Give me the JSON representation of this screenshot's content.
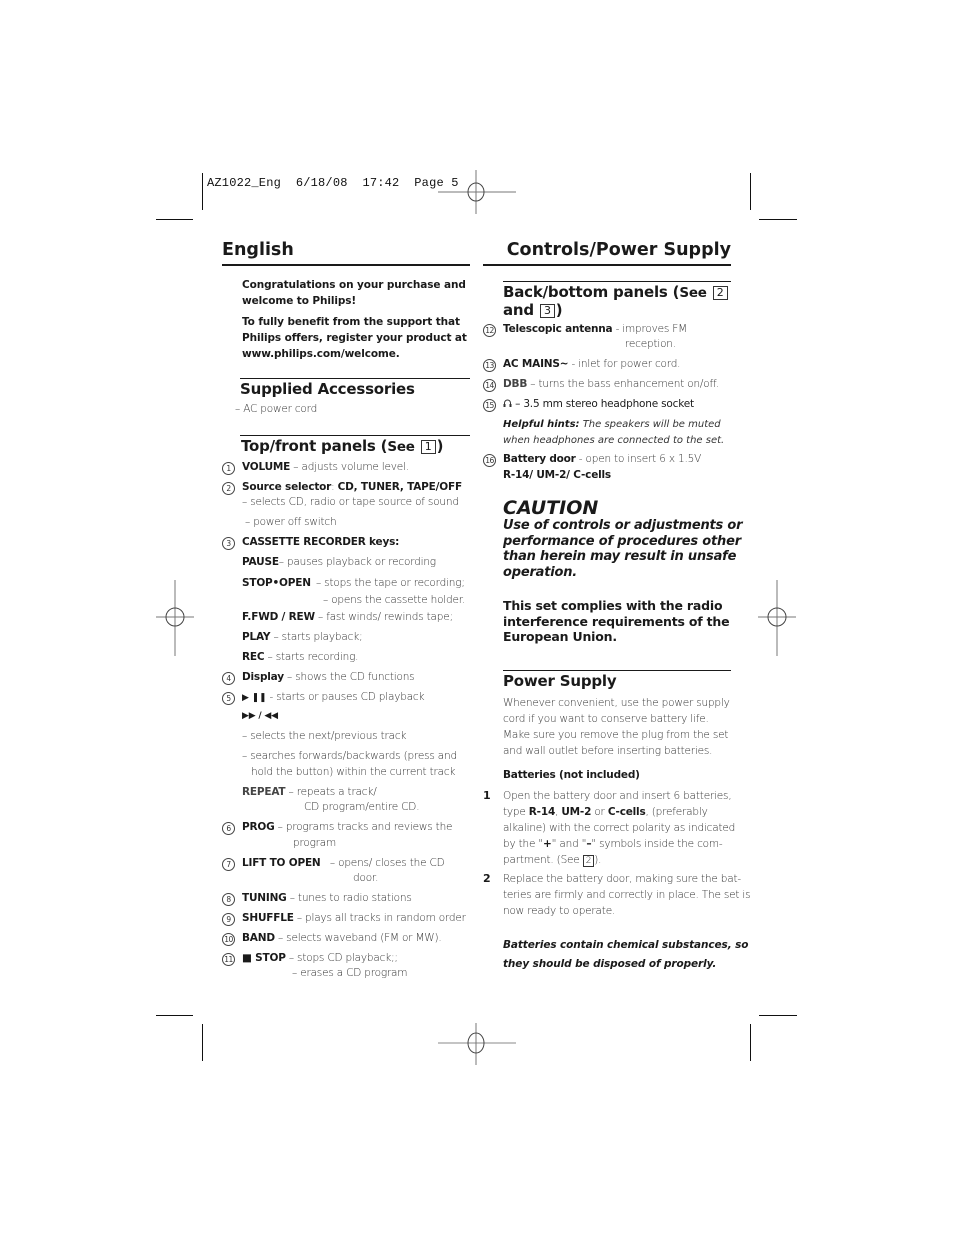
{
  "slug": {
    "file": "AZ1022_Eng",
    "date": "6/18/08",
    "time": "17:42",
    "page_label": "Page 5"
  },
  "header": {
    "left_title": "English",
    "right_title": "Controls/Power Supply"
  },
  "intro": {
    "para1_line1": "Congratulations on your purchase and",
    "para1_line2": "welcome to Philips!",
    "para2_line1": "To fully benefit from the support that",
    "para2_line2": "Philips offers, register your product at",
    "para2_line3": "www.philips.com/welcome."
  },
  "supplied_accessories": {
    "title": "Supplied Accessories",
    "items": [
      "– AC power cord"
    ]
  },
  "top_front_panels": {
    "title": "Top/front panels (",
    "see": "See",
    "ref": "1",
    "close": ")",
    "items": [
      {
        "num": "1",
        "label": "VOLUME",
        "desc": " – adjusts volume level."
      },
      {
        "num": "2",
        "label": "Source selector",
        "sep": ": ",
        "label2": "CD, TUNER, TAPE/OFF",
        "desc_lines": [
          "– selects CD, radio or tape source of sound",
          "– power off switch"
        ]
      },
      {
        "num": "3",
        "label": "CASSETTE RECORDER keys:"
      },
      {
        "label": "PAUSE",
        "desc": "– pauses playback or recording"
      },
      {
        "label": "STOP•OPEN",
        "desc": " – stops the tape or recording;",
        "desc2": "– opens the cassette holder."
      },
      {
        "label": "F.FWD / REW",
        "desc": " – fast winds/ rewinds tape;"
      },
      {
        "label": "PLAY",
        "desc": " – starts playback;"
      },
      {
        "label": "REC",
        "desc": " – starts recording."
      },
      {
        "num": "4",
        "label": "Display",
        "desc": " – shows the CD functions"
      },
      {
        "num": "5",
        "label": "▶ ❚❚",
        "desc": " - starts or pauses CD playback"
      },
      {
        "label": "▶▶ / ◀◀"
      },
      {
        "desc": "– selects the next/previous track"
      },
      {
        "desc": "– searches forwards/backwards (press and",
        "desc2": "hold the button) within the current track"
      },
      {
        "label": "REPEAT",
        "desc": " – repeats a track/",
        "desc2": "CD program/entire CD."
      },
      {
        "num": "6",
        "label": "PROG",
        "desc": " – programs tracks and reviews the",
        "desc2": "program"
      },
      {
        "num": "7",
        "label": "LIFT TO OPEN",
        "desc": "   – opens/ closes the CD",
        "desc2": "door."
      },
      {
        "num": "8",
        "label": "TUNING",
        "desc": " – tunes to radio stations"
      },
      {
        "num": "9",
        "label": "SHUFFLE",
        "desc": " – plays all tracks in random order"
      },
      {
        "num": "10",
        "label": "BAND",
        "desc": " – selects waveband (FM or MW)."
      },
      {
        "num": "11",
        "label": "■ STOP",
        "desc": " – stops CD playback;;",
        "desc2": "– erases a CD program"
      }
    ]
  },
  "back_bottom_panels": {
    "title": "Back/bottom panels (",
    "see": "See",
    "ref1": "2",
    "and": "and",
    "ref2": "3",
    "close": ")",
    "items": [
      {
        "num": "12",
        "label": "Telescopic antenna",
        "desc": " - improves FM",
        "desc2": "reception."
      },
      {
        "num": "13",
        "label": "AC MAINS~",
        "desc": " - inlet for power cord."
      },
      {
        "num": "14",
        "label": "DBB",
        "desc": " – turns the bass enhancement on/off."
      },
      {
        "num": "15",
        "icon": "headphone",
        "desc": "– 3.5 mm stereo headphone socket"
      },
      {
        "hint_label": "Helpful hints:",
        "hint": " The speakers will be muted",
        "hint2": "when headphones are connected to the set."
      },
      {
        "num": "16",
        "label": "Battery door",
        "desc": " - open to insert 6 x 1.5V",
        "label2": "R-14/ UM-2/ C-cells"
      }
    ]
  },
  "caution": {
    "title": "CAUTION",
    "lines": [
      "Use of controls or adjustments or",
      "performance of procedures other",
      "than herein may result in unsafe",
      "operation."
    ],
    "eu_lines": [
      "This set complies with the radio",
      "interference requirements of the",
      "European Union."
    ]
  },
  "power_supply": {
    "title": "Power Supply",
    "para": [
      "Whenever convenient, use the power supply",
      "cord if you want to conserve battery life.",
      "Make sure you remove the plug from the set",
      "and wall outlet before inserting batteries."
    ],
    "batteries_title": "Batteries (not included)",
    "steps": [
      {
        "num": "1",
        "lines": [
          "Open the battery door and insert 6 batteries,",
          "type ",
          "R-14",
          ", ",
          "UM-2",
          " or ",
          "C-cells",
          ", (preferably",
          "alkaline) with the correct polarity as indicated",
          "by the \"",
          "+",
          "\" and \"",
          "–",
          "\" symbols inside the com-",
          "partment. (See ",
          "2",
          ")."
        ]
      },
      {
        "num": "2",
        "lines": [
          "Replace the battery door, making sure the bat-",
          "teries are firmly and correctly in place. The set is",
          "now ready to operate."
        ]
      }
    ],
    "note": [
      "Batteries contain chemical substances, so",
      "they should be disposed of properly."
    ]
  }
}
